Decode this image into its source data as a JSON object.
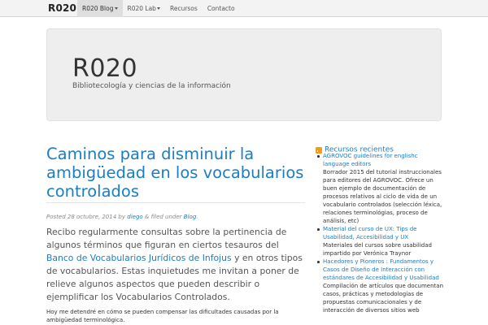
{
  "navbar": {
    "brand": "R020",
    "items": [
      {
        "label": "R020 Blog",
        "dropdown": true,
        "active": true
      },
      {
        "label": "R020 Lab",
        "dropdown": true,
        "active": false
      },
      {
        "label": "Recursos",
        "dropdown": false,
        "active": false
      },
      {
        "label": "Contacto",
        "dropdown": false,
        "active": false
      }
    ]
  },
  "hero": {
    "title": "R020",
    "subtitle": "Bibliotecología y ciencias de la información"
  },
  "post": {
    "title": "Caminos para disminuir la ambigüedad en los vocabularios controlados",
    "meta": {
      "posted_prefix": "Posted 28 octubre, 2014 by",
      "author": "diego",
      "filed_prefix": "& filed under",
      "category": "Blog",
      "period": "."
    },
    "lead": {
      "text1": "Recibo regularmente consultas sobre la pertinencia de algunos términos que figuran en ciertos tesauros del",
      "link": "Banco de Vocabularios Jurídicos de Infojus",
      "text2": "y en otros tipos de vocabularios. Estas inquietudes me invitan a poner de relieve algunos aspectos que pueden describir o ejemplificar los Vocabularios Controlados."
    },
    "paragraph": "Hoy me detendré en cómo se pueden compensar las dificultades causadas por la ambigüedad terminológica."
  },
  "sidebar": {
    "title": "Recursos recientes",
    "items": [
      {
        "link": "AGROVOC guidelines for englishc language editors",
        "desc": "Borrador 2015 del tutorial instruccionales para editores del AGROVOC. Ofrece un buen ejemplo de documentación de procesos relativos al ciclo de vida de un vocabulario controlados (selección léxica, relaciones terminológias, proceso de análisis, etc)"
      },
      {
        "link": "Material del curso de UX: Tips de Usabilidad, Accesibilidad y UX",
        "desc": "Materiales del cursos sobre usabilidad impartido por Verónica Traynor"
      },
      {
        "link": "Hacedores y Pioneros : Fundamentos y Casos de Diseño de Interacción con estándares de Accesibilidad y Usabilidad",
        "desc": "Compilación de artículos que documentan casos, prácticas y metodologías de propuestas comunicacionales y de interacción de diversos sitios web"
      }
    ]
  }
}
